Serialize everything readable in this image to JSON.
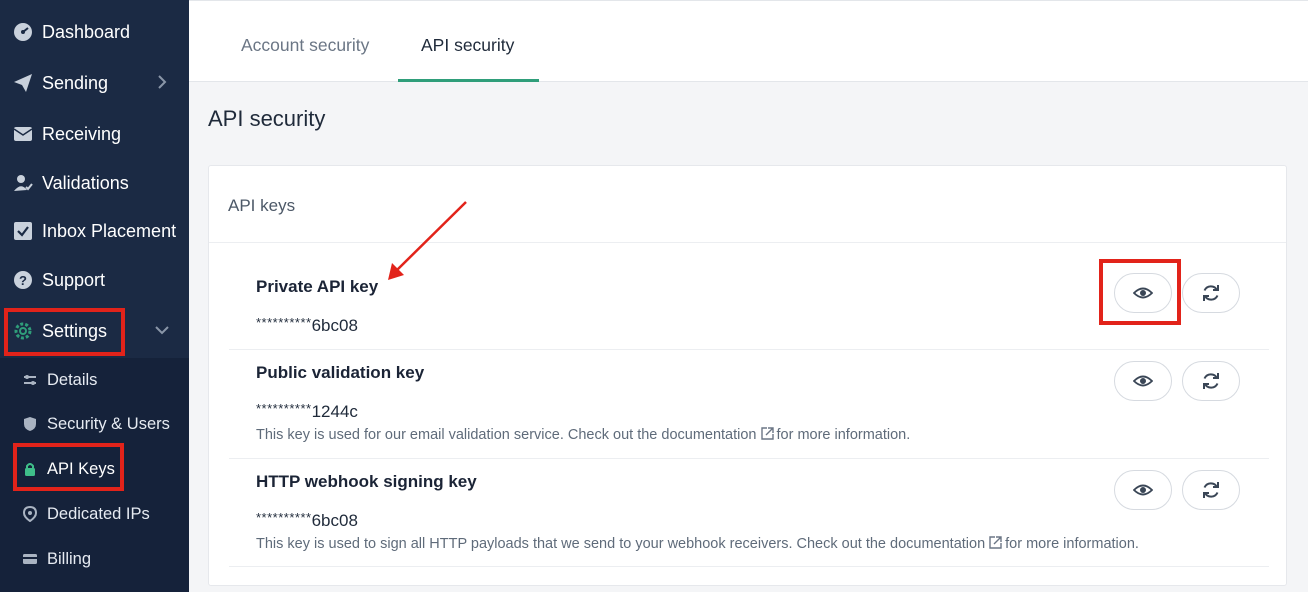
{
  "sidebar": {
    "items": [
      {
        "label": "Dashboard",
        "icon": "dashboard-icon"
      },
      {
        "label": "Sending",
        "icon": "paper-plane-icon"
      },
      {
        "label": "Receiving",
        "icon": "inbox-icon"
      },
      {
        "label": "Validations",
        "icon": "user-check-icon"
      },
      {
        "label": "Inbox Placement",
        "icon": "checkbox-icon"
      },
      {
        "label": "Support",
        "icon": "question-icon"
      },
      {
        "label": "Settings",
        "icon": "gear-icon"
      }
    ],
    "submenu": [
      {
        "label": "Details",
        "icon": "sliders-icon"
      },
      {
        "label": "Security & Users",
        "icon": "shield-icon"
      },
      {
        "label": "API Keys",
        "icon": "lock-icon"
      },
      {
        "label": "Dedicated IPs",
        "icon": "location-icon"
      },
      {
        "label": "Billing",
        "icon": "card-icon"
      }
    ]
  },
  "tabs": [
    {
      "label": "Account security"
    },
    {
      "label": "API security"
    }
  ],
  "page": {
    "title": "API security",
    "card_title": "API keys"
  },
  "keys": [
    {
      "name": "Private API key",
      "mask": "**********",
      "suffix": "6bc08",
      "desc": ""
    },
    {
      "name": "Public validation key",
      "mask": "**********",
      "suffix": "1244c",
      "desc_before": "This key is used for our email validation service. Check out the documentation",
      "desc_after": "for more information."
    },
    {
      "name": "HTTP webhook signing key",
      "mask": "**********",
      "suffix": "6bc08",
      "desc_before": "This key is used to sign all HTTP payloads that we send to your webhook receivers. Check out the documentation",
      "desc_after": "for more information."
    }
  ],
  "colors": {
    "sidebar_bg": "#1b2a44",
    "accent": "#2f9e7a",
    "annotation_red": "#e2231a"
  }
}
